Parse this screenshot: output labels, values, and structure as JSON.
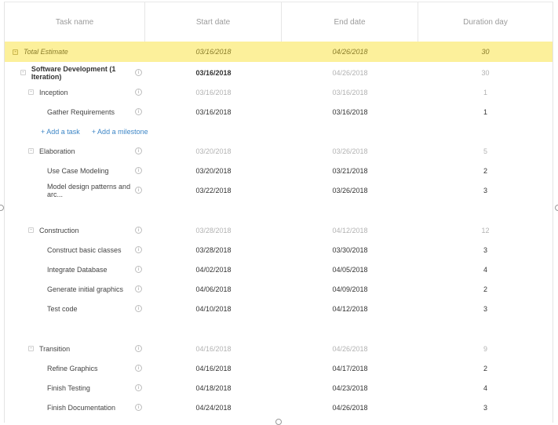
{
  "columns": [
    "Task name",
    "Start date",
    "End date",
    "Duration day"
  ],
  "rows": [
    {
      "kind": "total",
      "task": "Total Estimate",
      "start": "03/16/2018",
      "end": "04/26/2018",
      "dur": "30",
      "level": 0,
      "toggle": "-"
    },
    {
      "kind": "project",
      "task": "Software Development (1 Iteration)",
      "start": "03/16/2018",
      "end": "04/26/2018",
      "dur": "30",
      "level": 1,
      "toggle": "-"
    },
    {
      "kind": "phase",
      "task": "Inception",
      "start": "03/16/2018",
      "end": "03/16/2018",
      "dur": "1",
      "level": 2,
      "toggle": "-"
    },
    {
      "kind": "task",
      "task": "Gather Requirements",
      "start": "03/16/2018",
      "end": "03/16/2018",
      "dur": "1",
      "level": 3
    },
    {
      "kind": "add",
      "add_task": "+ Add a task",
      "add_milestone": "+ Add a milestone"
    },
    {
      "kind": "phase",
      "task": "Elaboration",
      "start": "03/20/2018",
      "end": "03/26/2018",
      "dur": "5",
      "level": 2,
      "toggle": "-"
    },
    {
      "kind": "task",
      "task": "Use Case Modeling",
      "start": "03/20/2018",
      "end": "03/21/2018",
      "dur": "2",
      "level": 3
    },
    {
      "kind": "task",
      "task": "Model design patterns and arc...",
      "start": "03/22/2018",
      "end": "03/26/2018",
      "dur": "3",
      "level": 3
    },
    {
      "kind": "phase",
      "task": "Construction",
      "start": "03/28/2018",
      "end": "04/12/2018",
      "dur": "12",
      "level": 2,
      "toggle": "-"
    },
    {
      "kind": "task",
      "task": "Construct basic classes",
      "start": "03/28/2018",
      "end": "03/30/2018",
      "dur": "3",
      "level": 3
    },
    {
      "kind": "task",
      "task": "Integrate Database",
      "start": "04/02/2018",
      "end": "04/05/2018",
      "dur": "4",
      "level": 3
    },
    {
      "kind": "task",
      "task": "Generate initial graphics",
      "start": "04/06/2018",
      "end": "04/09/2018",
      "dur": "2",
      "level": 3
    },
    {
      "kind": "task",
      "task": "Test code",
      "start": "04/10/2018",
      "end": "04/12/2018",
      "dur": "3",
      "level": 3
    },
    {
      "kind": "phase",
      "task": "Transition",
      "start": "04/16/2018",
      "end": "04/26/2018",
      "dur": "9",
      "level": 2,
      "toggle": "-"
    },
    {
      "kind": "task",
      "task": "Refine Graphics",
      "start": "04/16/2018",
      "end": "04/17/2018",
      "dur": "2",
      "level": 3
    },
    {
      "kind": "task",
      "task": "Finish Testing",
      "start": "04/18/2018",
      "end": "04/23/2018",
      "dur": "4",
      "level": 3
    },
    {
      "kind": "task",
      "task": "Finish Documentation",
      "start": "04/24/2018",
      "end": "04/26/2018",
      "dur": "3",
      "level": 3
    }
  ],
  "info_glyph": "i"
}
